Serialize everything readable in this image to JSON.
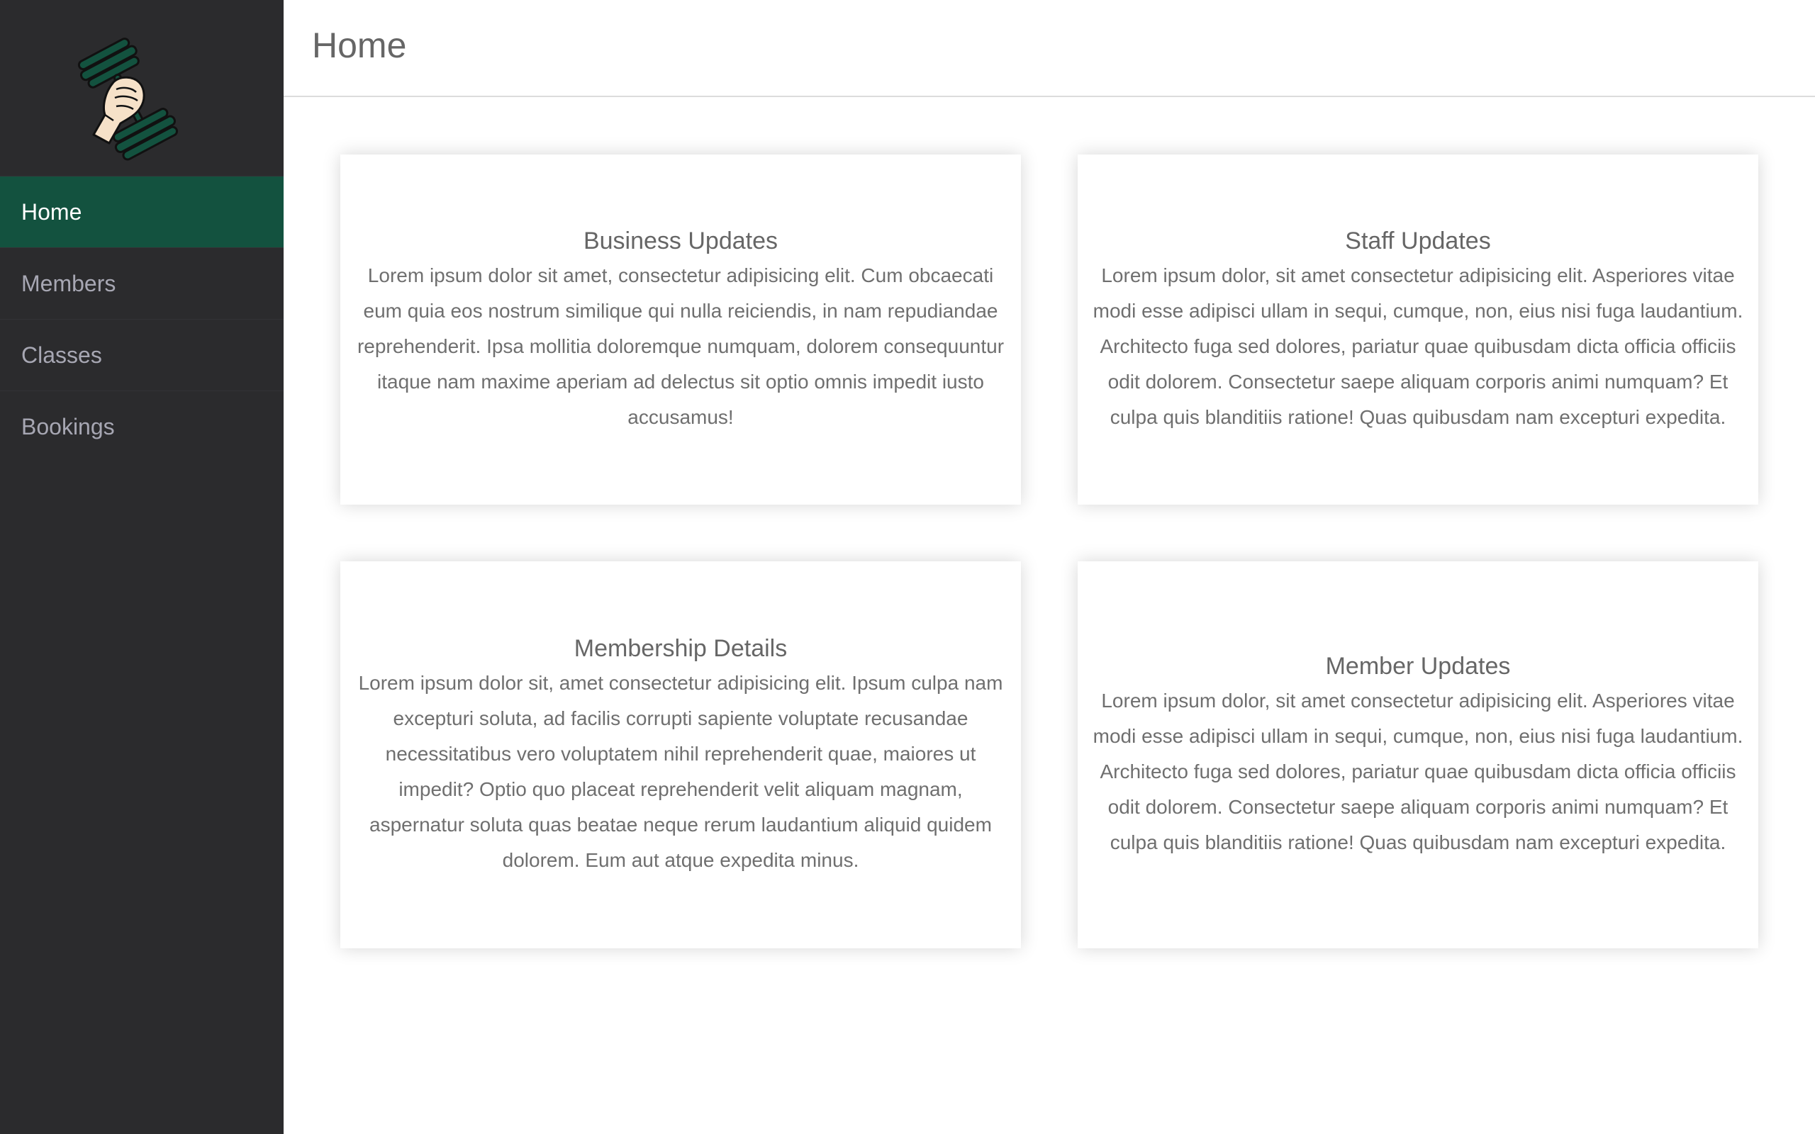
{
  "app": {
    "logo_icon": "dumbbell-fist-icon",
    "colors": {
      "sidebar_bg": "#2b2b2d",
      "accent": "#13523f",
      "nav_text": "#a7a7b3",
      "active_text": "#ffffff"
    }
  },
  "sidebar": {
    "items": [
      {
        "label": "Home",
        "active": true
      },
      {
        "label": "Members",
        "active": false
      },
      {
        "label": "Classes",
        "active": false
      },
      {
        "label": "Bookings",
        "active": false
      }
    ]
  },
  "header": {
    "title": "Home"
  },
  "cards": [
    {
      "title": "Business Updates",
      "body": "Lorem ipsum dolor sit amet, consectetur adipisicing elit. Cum obcaecati eum quia eos nostrum similique qui nulla reiciendis, in nam repudiandae reprehenderit. Ipsa mollitia doloremque numquam, dolorem consequuntur itaque nam maxime aperiam ad delectus sit optio omnis impedit iusto accusamus!"
    },
    {
      "title": "Staff Updates",
      "body": "Lorem ipsum dolor, sit amet consectetur adipisicing elit. Asperiores vitae modi esse adipisci ullam in sequi, cumque, non, eius nisi fuga laudantium. Architecto fuga sed dolores, pariatur quae quibusdam dicta officia officiis odit dolorem. Consectetur saepe aliquam corporis animi numquam? Et culpa quis blanditiis ratione! Quas quibusdam nam excepturi expedita."
    },
    {
      "title": "Membership Details",
      "body": "Lorem ipsum dolor sit, amet consectetur adipisicing elit. Ipsum culpa nam excepturi soluta, ad facilis corrupti sapiente voluptate recusandae necessitatibus vero voluptatem nihil reprehenderit quae, maiores ut impedit? Optio quo placeat reprehenderit velit aliquam magnam, aspernatur soluta quas beatae neque rerum laudantium aliquid quidem dolorem. Eum aut atque expedita minus."
    },
    {
      "title": "Member Updates",
      "body": "Lorem ipsum dolor, sit amet consectetur adipisicing elit. Asperiores vitae modi esse adipisci ullam in sequi, cumque, non, eius nisi fuga laudantium. Architecto fuga sed dolores, pariatur quae quibusdam dicta officia officiis odit dolorem. Consectetur saepe aliquam corporis animi numquam? Et culpa quis blanditiis ratione! Quas quibusdam nam excepturi expedita."
    }
  ]
}
